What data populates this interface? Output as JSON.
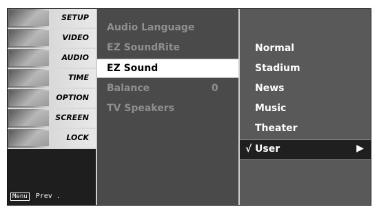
{
  "left_menu": {
    "items": [
      {
        "label": "SETUP",
        "icon": "setup-icon"
      },
      {
        "label": "VIDEO",
        "icon": "video-icon"
      },
      {
        "label": "AUDIO",
        "icon": "audio-icon"
      },
      {
        "label": "TIME",
        "icon": "clock-icon"
      },
      {
        "label": "OPTION",
        "icon": "option-icon"
      },
      {
        "label": "SCREEN",
        "icon": "screen-icon"
      },
      {
        "label": "LOCK",
        "icon": "lock-icon"
      }
    ],
    "prev_badge": "Menu",
    "prev_label": "Prev ."
  },
  "audio_menu": {
    "items": [
      {
        "label": "Audio Language",
        "value": ""
      },
      {
        "label": "EZ SoundRite",
        "value": ""
      },
      {
        "label": "EZ Sound",
        "value": ""
      },
      {
        "label": "Balance",
        "value": "0"
      },
      {
        "label": "TV Speakers",
        "value": ""
      }
    ],
    "active_index": 2
  },
  "ez_sound_options": {
    "items": [
      "Normal",
      "Stadium",
      "News",
      "Music",
      "Theater",
      "User"
    ],
    "selected_index": 5,
    "check_glyph": "√",
    "arrow_glyph": "▶"
  },
  "colors": {
    "panel_dark": "#1e1e1e",
    "panel_mid": "#4a4a4a",
    "panel_right": "#595959",
    "highlight": "#ffffff"
  }
}
